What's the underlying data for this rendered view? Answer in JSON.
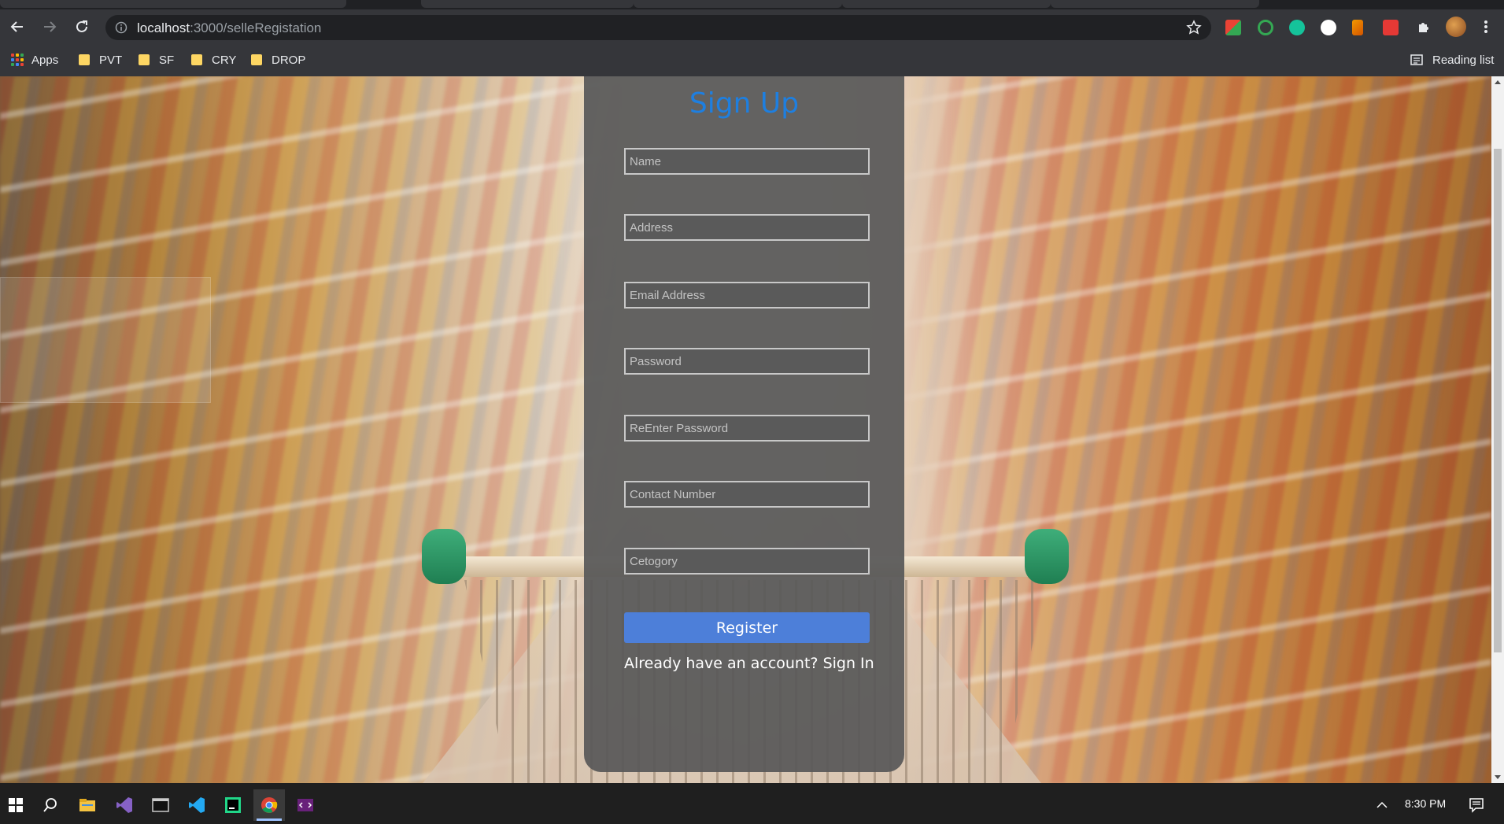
{
  "browser": {
    "url_host": "localhost",
    "url_path": ":3000/selleRegistation",
    "bookmarks": [
      {
        "label": "Apps"
      },
      {
        "label": "PVT"
      },
      {
        "label": "SF"
      },
      {
        "label": "CRY"
      },
      {
        "label": "DROP"
      }
    ],
    "reading_list_label": "Reading list"
  },
  "form": {
    "title": "Sign Up",
    "fields": [
      {
        "placeholder": "Name"
      },
      {
        "placeholder": "Address"
      },
      {
        "placeholder": "Email Address"
      },
      {
        "placeholder": "Password"
      },
      {
        "placeholder": "ReEnter Password"
      },
      {
        "placeholder": "Contact Number"
      },
      {
        "placeholder": "Cetogory"
      }
    ],
    "register_label": "Register",
    "signin_prompt": "Already have an account?",
    "signin_link": "Sign In",
    "title_color": "#1e7fe0",
    "button_color": "#4d7fd9"
  },
  "taskbar": {
    "time": "8:30 PM"
  }
}
